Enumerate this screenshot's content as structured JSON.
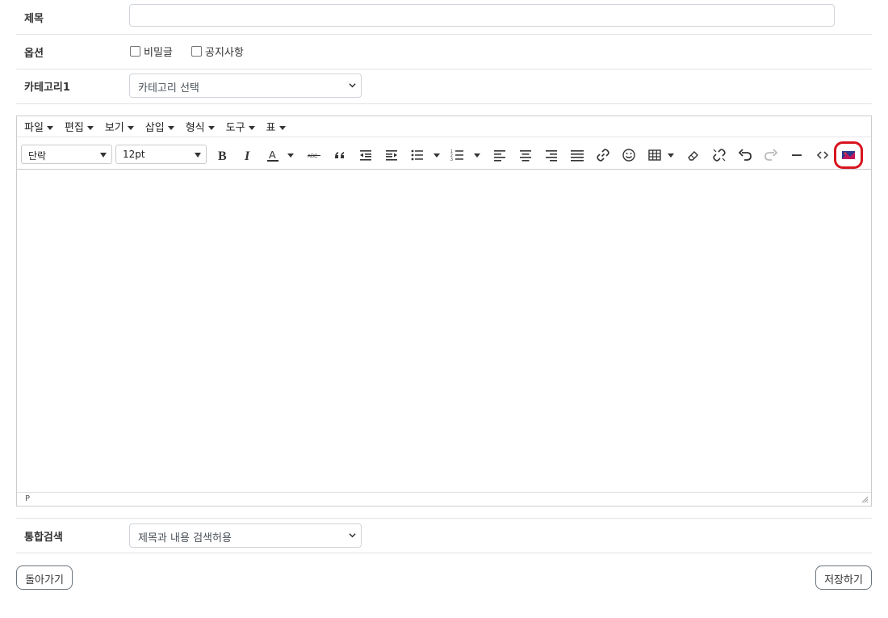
{
  "form": {
    "title_label": "제목",
    "title_value": "",
    "options_label": "옵션",
    "option_secret": "비밀글",
    "option_notice": "공지사항",
    "category_label": "카테고리1",
    "category_selected": "카테고리 선택",
    "search_label": "통합검색",
    "search_selected": "제목과 내용 검색허용"
  },
  "editor": {
    "menus": [
      "파일",
      "편집",
      "보기",
      "삽입",
      "형식",
      "도구",
      "표"
    ],
    "block_format": "단락",
    "font_size": "12pt",
    "status_path": "P",
    "toolbar_icons": [
      "bold-icon",
      "italic-icon",
      "text-color-icon",
      "strikethrough-icon",
      "blockquote-icon",
      "outdent-icon",
      "indent-icon",
      "bullet-list-icon",
      "numbered-list-icon",
      "align-left-icon",
      "align-center-icon",
      "align-right-icon",
      "align-justify-icon",
      "link-icon",
      "emoticon-icon",
      "table-icon",
      "eraser-icon",
      "unlink-icon",
      "undo-icon",
      "redo-icon",
      "horizontal-rule-icon",
      "source-code-icon",
      "image-upload-icon"
    ]
  },
  "buttons": {
    "back": "돌아가기",
    "save": "저장하기"
  },
  "colors": {
    "highlight": "#d9141e",
    "border": "#ced4da"
  }
}
